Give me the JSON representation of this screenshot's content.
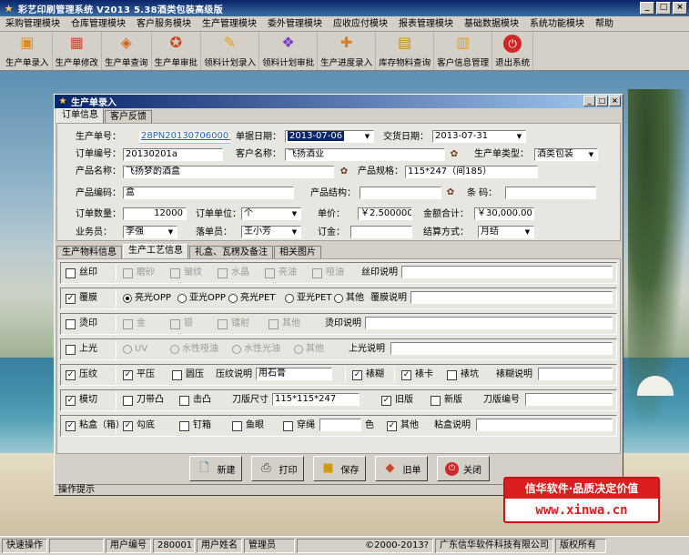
{
  "app": {
    "title": "彩艺印刷管理系统   V2013 5.38酒类包装高级版",
    "min": "_",
    "max": "□",
    "close": "×"
  },
  "menu": [
    "采购管理模块",
    "仓库管理模块",
    "客户服务模块",
    "生产管理模块",
    "委外管理模块",
    "应收应付模块",
    "报表管理模块",
    "基础数据模块",
    "系统功能模块",
    "帮助"
  ],
  "toolbar": [
    "生产单录入",
    "生产单修改",
    "生产单查询",
    "生产单审批",
    "领料计划录入",
    "领料计划审批",
    "生产进度录入",
    "库存物料查询",
    "客户信息管理",
    "退出系统"
  ],
  "window": {
    "title": "生产单录入",
    "tabs": [
      "订单信息",
      "客户反馈"
    ],
    "fields": {
      "order_no_label": "生产单号：",
      "order_no": "28PN201307060001",
      "order_date_label": "单据日期：",
      "order_date": "2013-07-06",
      "delivery_date_label": "交货日期：",
      "delivery_date": "2013-07-31",
      "order_code_label": "订单编号：",
      "order_code": "20130201a",
      "customer_label": "客户名称：",
      "customer": "飞扬酒业",
      "type_label": "生产单类型：",
      "type": "酒类包装",
      "product_label": "产品名称：",
      "product": "飞扬梦酌酒盒",
      "spec_label": "产品规格：",
      "spec": "115*247（间185）",
      "product_code_label": "产品编码：",
      "product_code": "盒",
      "structure_label": "产品结构：",
      "structure": "",
      "barcode_label": "条  码：",
      "barcode": "",
      "qty_label": "订单数量：",
      "qty": "12000",
      "unit_label": "订单单位：",
      "unit": "个",
      "price_label": "单价：",
      "price": "￥2.500000",
      "amount_label": "金额合计：",
      "amount": "￥30,000.00",
      "sales_label": "业务员：",
      "sales": "李强",
      "creator_label": "落单员：",
      "creator": "王小芳",
      "deposit_label": "订金：",
      "deposit": "",
      "settle_label": "结算方式：",
      "settle": "月结"
    },
    "subtabs": [
      "生产物料信息",
      "生产工艺信息",
      "礼盒、瓦楞及备注",
      "相关图片"
    ],
    "craft": {
      "silk": {
        "label": "丝印",
        "checked": false,
        "opts": [
          "磨砂",
          "皱纹",
          "水晶",
          "亮油",
          "哑油"
        ],
        "desc_label": "丝印说明",
        "desc": ""
      },
      "film": {
        "label": "覆膜",
        "checked": true,
        "opts": [
          "亮光OPP",
          "亚光OPP",
          "亮光PET",
          "亚光PET",
          "其他"
        ],
        "selected": 0,
        "desc_label": "覆膜说明",
        "desc": ""
      },
      "foil": {
        "label": "烫印",
        "checked": false,
        "opts": [
          "金",
          "银",
          "镭射",
          "其他"
        ],
        "desc_label": "烫印说明",
        "desc": ""
      },
      "gloss": {
        "label": "上光",
        "checked": false,
        "opts": [
          "UV",
          "水性哑油",
          "水性光油",
          "其他"
        ],
        "desc_label": "上光说明",
        "desc": ""
      },
      "press": {
        "label": "压纹",
        "checked": true,
        "opt1": "平压",
        "opt2": "圆压",
        "desc_label": "压纹说明",
        "desc": "用石膏",
        "mount_label": "裱糊",
        "opt3": "裱卡",
        "opt4": "裱坑",
        "mount_desc_label": "裱糊说明",
        "mount_desc": ""
      },
      "die": {
        "label": "模切",
        "checked": true,
        "opt1": "刀带凸",
        "opt2": "击凸",
        "size_label": "刀版尺寸",
        "size": "115*115*247",
        "opt3": "旧版",
        "opt4": "新版",
        "code_label": "刀版编号",
        "code": ""
      },
      "glue": {
        "label": "粘盒（箱）",
        "checked": true,
        "opt1": "勾底",
        "opt2": "钉箱",
        "opt3": "鱼眼",
        "opt4": "穿绳",
        "color_label": "色",
        "opt5": "其他",
        "desc_label": "粘盒说明",
        "desc": ""
      }
    },
    "actions": [
      "新建",
      "打印",
      "保存",
      "旧单",
      "关闭"
    ],
    "hint": "操作提示"
  },
  "promo": {
    "top": "信华软件·品质决定价值",
    "bottom": "www.xinwa.cn"
  },
  "status": {
    "quick": "快速操作",
    "blank": "",
    "user_no_label": "用户编号",
    "user_no": "280001",
    "user_name_label": "用户姓名",
    "user_name": "管理员",
    "copyright": "©2000-2013?",
    "company": "广东信华软件科技有限公司",
    "rights": "版权所有"
  },
  "colors": {
    "title_dark": "#0a246a",
    "title_light": "#a6caf0",
    "promo_red": "#d81e1e",
    "link": "#1b5fc8"
  }
}
